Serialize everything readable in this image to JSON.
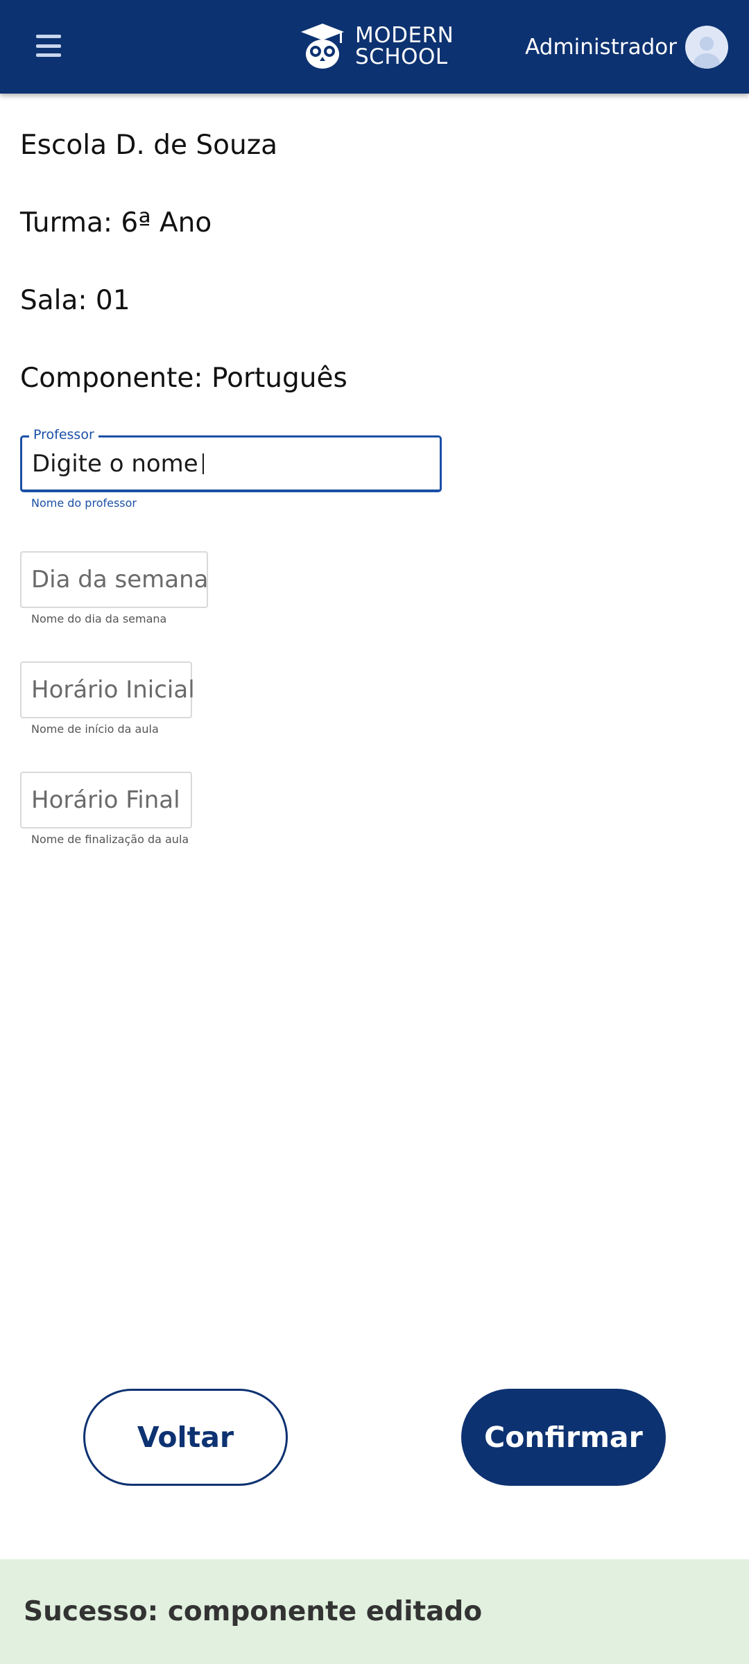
{
  "header": {
    "logo_line1": "MODERN",
    "logo_line2": "SCHOOL",
    "user_name": "Administrador"
  },
  "info": {
    "school": "Escola D. de Souza",
    "class": "Turma: 6ª Ano",
    "room": "Sala: 01",
    "component": "Componente: Português"
  },
  "fields": {
    "teacher": {
      "label": "Professor",
      "value": "Digite o nome",
      "helper": "Nome do professor"
    },
    "weekday": {
      "placeholder": "Dia da semana",
      "helper": "Nome do dia da semana"
    },
    "start_time": {
      "placeholder": "Horário Inicial",
      "helper": "Nome de início da aula"
    },
    "end_time": {
      "placeholder": "Horário Final",
      "helper": "Nome de finalização da aula"
    }
  },
  "actions": {
    "back_label": "Voltar",
    "confirm_label": "Confirmar"
  },
  "toast": {
    "message": "Sucesso: componente editado"
  },
  "colors": {
    "primary": "#0d3271",
    "focus": "#1a4fa6",
    "success_bg": "#e1f0df"
  },
  "icons": {
    "menu": "hamburger-menu-icon",
    "logo": "owl-graduation-cap-logo",
    "avatar": "user-avatar-icon"
  }
}
